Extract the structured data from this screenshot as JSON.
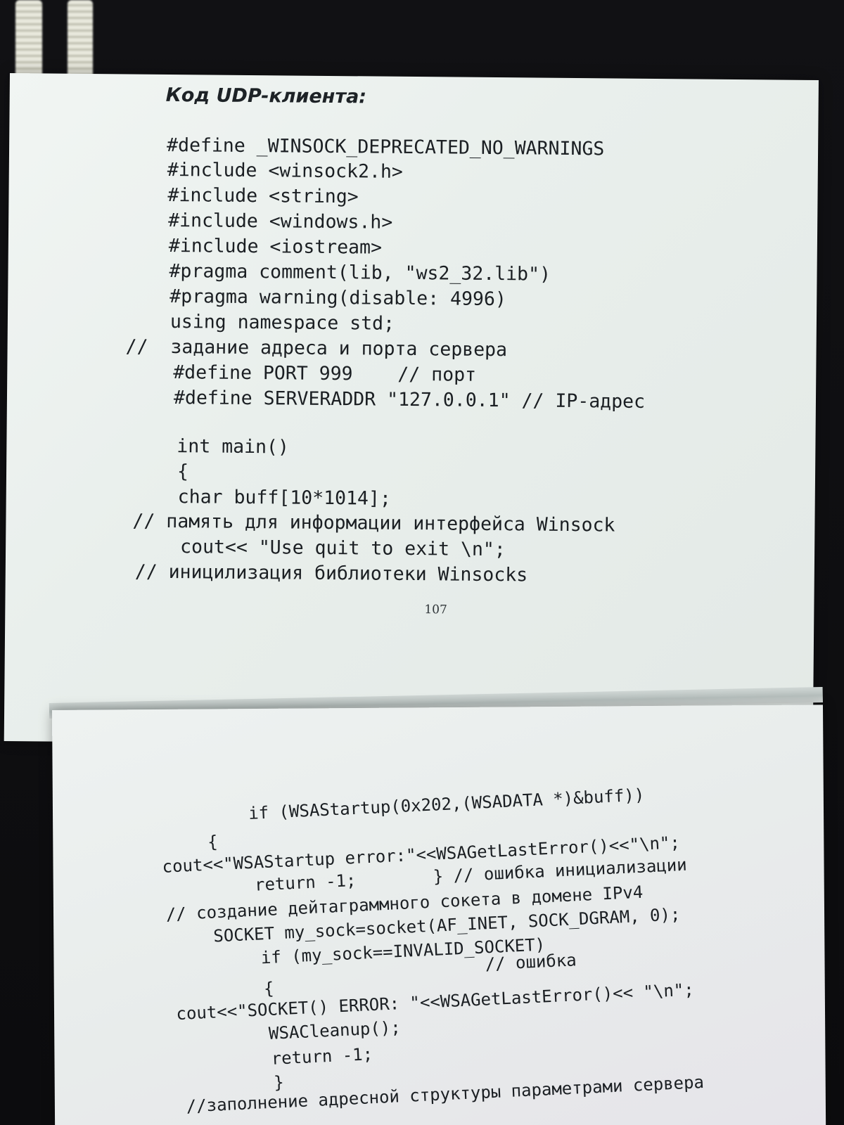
{
  "document": {
    "top_page": {
      "heading": "Код UDP-клиента:",
      "lines": [
        "#define _WINSOCK_DEPRECATED_NO_WARNINGS",
        "#include <winsock2.h>",
        "#include <string>",
        "#include <windows.h>",
        "#include <iostream>",
        "#pragma comment(lib, \"ws2_32.lib\")",
        "#pragma warning(disable: 4996)",
        "using namespace std;",
        "//  задание адреса и порта сервера",
        "#define PORT 999    // порт",
        "#define SERVERADDR \"127.0.0.1\" // IP-адрес",
        "int main()",
        "{",
        "char buff[10*1014];",
        "// память для информации интерфейса Winsock",
        "cout<< \"Use quit to exit \\n\";",
        "// иницилизация библиотеки Winsocks"
      ],
      "page_number": "107"
    },
    "bottom_page": {
      "lines": [
        "if (WSAStartup(0x202,(WSADATA *)&buff))",
        "{",
        "cout<<\"WSAStartup error:\"<<WSAGetLastError()<<\"\\n\";",
        "return -1;",
        "} // ошибка инициализации",
        "// создание дейтаграммного сокета в домене IPv4",
        "SOCKET my_sock=socket(AF_INET, SOCK_DGRAM, 0);",
        "if (my_sock==INVALID_SOCKET)",
        "// ошибка",
        "{",
        "cout<<\"SOCKET() ERROR: \"<<WSAGetLastError()<< \"\\n\";",
        "WSACleanup();",
        "return -1;",
        "}",
        "//заполнение адресной структуры параметрами сервера"
      ]
    }
  }
}
